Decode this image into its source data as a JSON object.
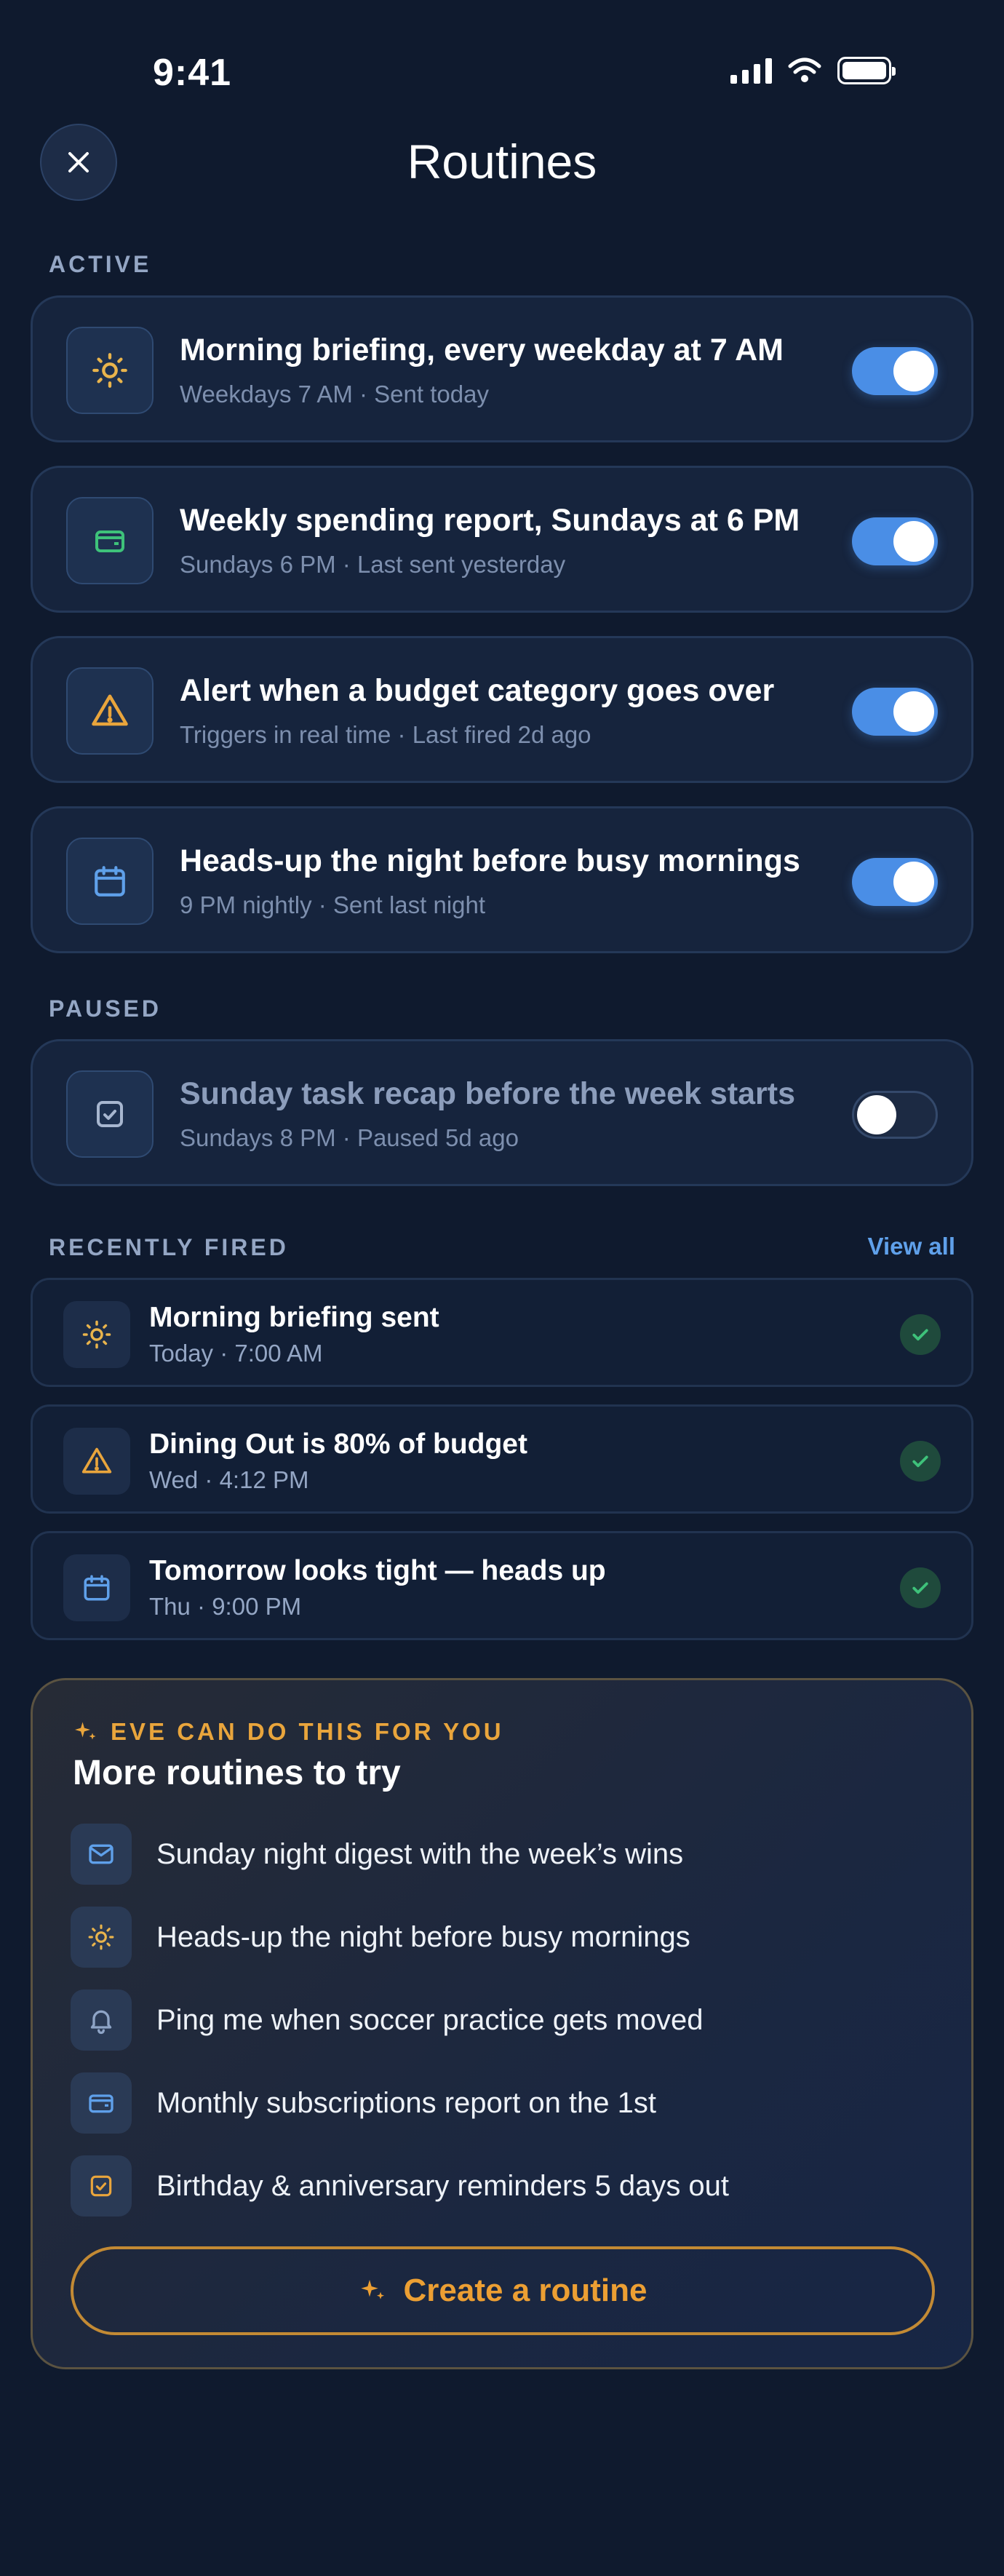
{
  "status_bar": {
    "time": "9:41"
  },
  "header": {
    "title": "Routines"
  },
  "sections": {
    "active": "ACTIVE",
    "paused": "PAUSED",
    "recently_fired": "RECENTLY FIRED",
    "view_all": "View all"
  },
  "active_routines": [
    {
      "title": "Morning briefing, every weekday at 7 AM",
      "subtitle": "Weekdays 7 AM · Sent today",
      "icon": "sun-icon",
      "enabled": true
    },
    {
      "title": "Weekly spending report, Sundays at 6 PM",
      "subtitle": "Sundays 6 PM · Last sent yesterday",
      "icon": "wallet-icon",
      "enabled": true
    },
    {
      "title": "Alert when a budget category goes over",
      "subtitle": "Triggers in real time · Last fired 2d ago",
      "icon": "warning-icon",
      "enabled": true
    },
    {
      "title": "Heads-up the night before busy mornings",
      "subtitle": "9 PM nightly · Sent last night",
      "icon": "calendar-icon",
      "enabled": true
    }
  ],
  "paused_routines": [
    {
      "title": "Sunday task recap before the week starts",
      "subtitle": "Sundays 8 PM · Paused 5d ago",
      "icon": "checkbox-icon",
      "enabled": false
    }
  ],
  "recently_fired": [
    {
      "title": "Morning briefing sent",
      "subtitle": "Today · 7:00 AM",
      "icon": "sun-icon"
    },
    {
      "title": "Dining Out is 80% of budget",
      "subtitle": "Wed · 4:12 PM",
      "icon": "warning-icon"
    },
    {
      "title": "Tomorrow looks tight — heads up",
      "subtitle": "Thu · 9:00 PM",
      "icon": "calendar-icon"
    }
  ],
  "suggestions": {
    "eyebrow": "EVE CAN DO THIS FOR YOU",
    "title": "More routines to try",
    "items": [
      {
        "text": "Sunday night digest with the week’s wins",
        "icon": "mail-icon"
      },
      {
        "text": "Heads-up the night before busy mornings",
        "icon": "sun-icon"
      },
      {
        "text": "Ping me when soccer practice gets moved",
        "icon": "bell-icon"
      },
      {
        "text": "Monthly subscriptions report on the 1st",
        "icon": "card-icon"
      },
      {
        "text": "Birthday & anniversary reminders 5 days out",
        "icon": "checkbox-icon"
      }
    ],
    "button_label": "Create a routine"
  },
  "colors": {
    "background": "#0f1a2e",
    "accent_blue": "#4a8ee6",
    "accent_gold": "#ec9f33",
    "success_green": "#3ea872"
  }
}
